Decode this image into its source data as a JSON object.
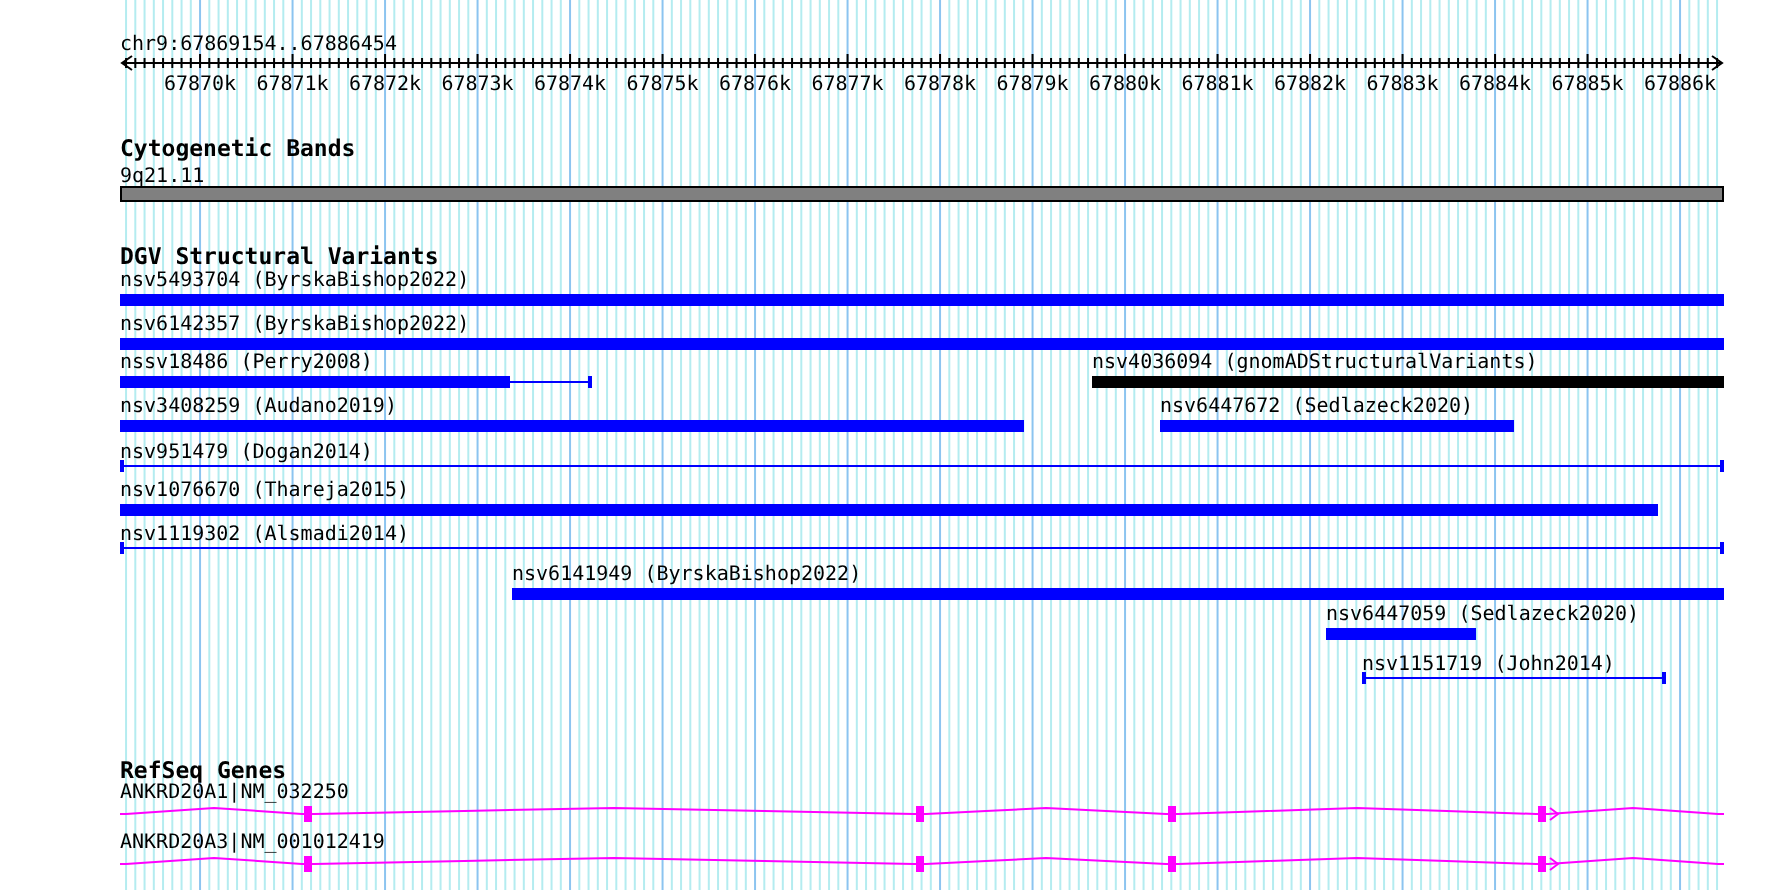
{
  "ruler": {
    "range": "chr9:67869154..67886454",
    "ticks": [
      "67870k",
      "67871k",
      "67872k",
      "67873k",
      "67874k",
      "67875k",
      "67876k",
      "67877k",
      "67878k",
      "67879k",
      "67880k",
      "67881k",
      "67882k",
      "67883k",
      "67884k",
      "67885k",
      "67886k"
    ]
  },
  "cytoband_track": {
    "title": "Cytogenetic Bands",
    "bands": [
      {
        "label": "9q21.11"
      }
    ]
  },
  "variant_track": {
    "title": "DGV Structural Variants",
    "features": [
      {
        "label": "nsv5493704 (ByrskaBishop2022)",
        "kind": "bar",
        "color": "#0000ff"
      },
      {
        "label": "nsv6142357 (ByrskaBishop2022)",
        "kind": "bar",
        "color": "#0000ff"
      },
      {
        "label": "nssv18486 (Perry2008)",
        "kind": "bar_line",
        "color": "#0000ff"
      },
      {
        "label": "nsv4036094 (gnomADStructuralVariants)",
        "kind": "bar",
        "color": "#000000"
      },
      {
        "label": "nsv3408259 (Audano2019)",
        "kind": "bar",
        "color": "#0000ff"
      },
      {
        "label": "nsv6447672 (Sedlazeck2020)",
        "kind": "bar",
        "color": "#0000ff"
      },
      {
        "label": "nsv951479 (Dogan2014)",
        "kind": "line",
        "color": "#0000ff"
      },
      {
        "label": "nsv1076670 (Thareja2015)",
        "kind": "bar",
        "color": "#0000ff"
      },
      {
        "label": "nsv1119302 (Alsmadi2014)",
        "kind": "line",
        "color": "#0000ff"
      },
      {
        "label": "nsv6141949 (ByrskaBishop2022)",
        "kind": "bar",
        "color": "#0000ff"
      },
      {
        "label": "nsv6447059 (Sedlazeck2020)",
        "kind": "bar",
        "color": "#0000ff"
      },
      {
        "label": "nsv1151719 (John2014)",
        "kind": "line",
        "color": "#0000ff"
      }
    ]
  },
  "gene_track": {
    "title": "RefSeq Genes",
    "genes": [
      {
        "label": "ANKRD20A1|NM_032250"
      },
      {
        "label": "ANKRD20A3|NM_001012419"
      }
    ]
  }
}
